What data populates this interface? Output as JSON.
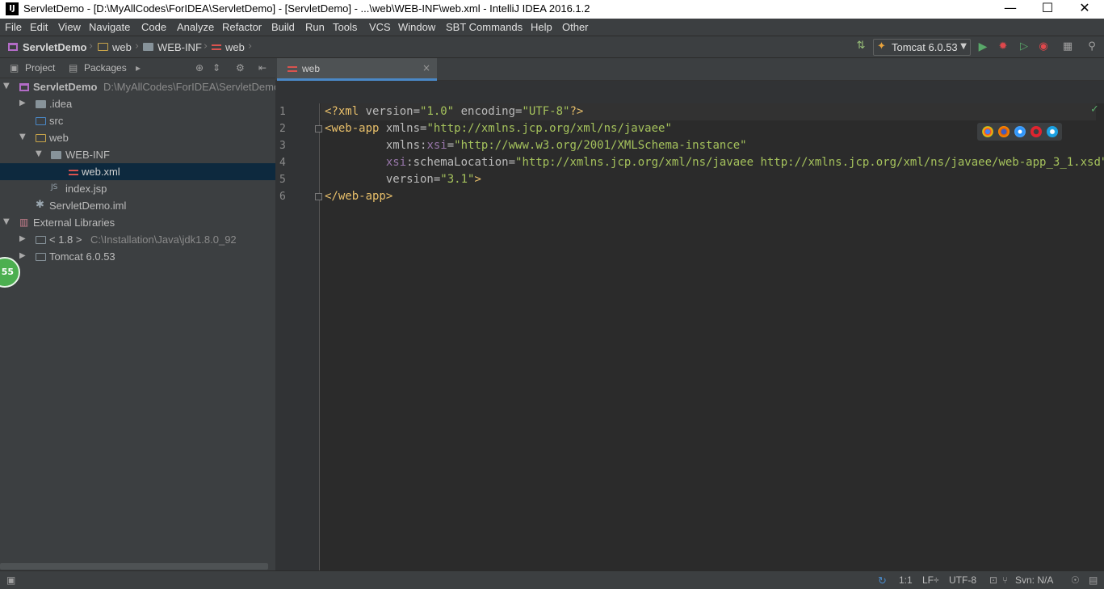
{
  "window": {
    "title": "ServletDemo - [D:\\MyAllCodes\\ForIDEA\\ServletDemo] - [ServletDemo] - ...\\web\\WEB-INF\\web.xml - IntelliJ IDEA 2016.1.2",
    "logo_text": "IJ",
    "minimize": "—",
    "maximize": "☐",
    "close": "✕"
  },
  "menu": [
    "File",
    "Edit",
    "View",
    "Navigate",
    "Code",
    "Analyze",
    "Refactor",
    "Build",
    "Run",
    "Tools",
    "VCS",
    "Window",
    "SBT Commands",
    "Help",
    "Other"
  ],
  "breadcrumb": [
    "ServletDemo",
    "web",
    "WEB-INF",
    "web"
  ],
  "toolbar": {
    "run_config": "Tomcat 6.0.53"
  },
  "project_panel": {
    "tabs": [
      "Project",
      "Packages"
    ],
    "tree": [
      {
        "label": "ServletDemo",
        "path": "D:\\MyAllCodes\\ForIDEA\\ServletDemo"
      },
      {
        "label": ".idea"
      },
      {
        "label": "src"
      },
      {
        "label": "web"
      },
      {
        "label": "WEB-INF"
      },
      {
        "label": "web.xml"
      },
      {
        "label": "index.jsp"
      },
      {
        "label": "ServletDemo.iml"
      },
      {
        "label": "External Libraries"
      },
      {
        "label": "< 1.8 >",
        "path": "C:\\Installation\\Java\\jdk1.8.0_92"
      },
      {
        "label": "Tomcat 6.0.53"
      }
    ],
    "badge": "55"
  },
  "editor": {
    "tab_label": "web",
    "tab_close": "×",
    "line_numbers": [
      "1",
      "2",
      "3",
      "4",
      "5",
      "6"
    ]
  },
  "statusbar": {
    "position": "1:1",
    "line_sep": "LF÷",
    "encoding": "UTF-8",
    "vcs": "Svn: N/A"
  }
}
